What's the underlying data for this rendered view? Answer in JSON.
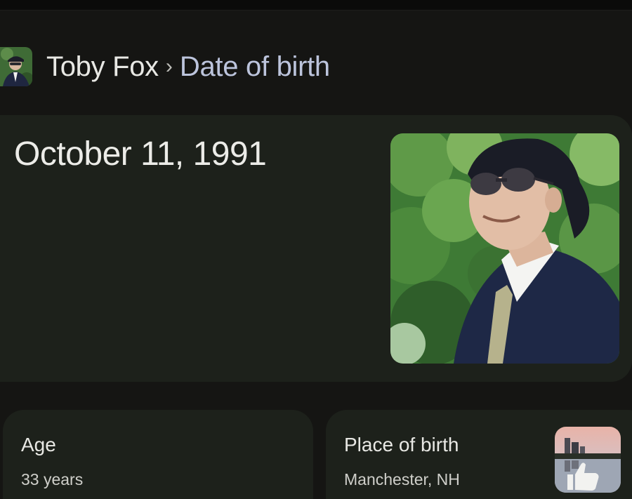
{
  "breadcrumb": {
    "entity": "Toby Fox",
    "separator": "›",
    "attribute": "Date of birth"
  },
  "answer": {
    "value": "October 11, 1991"
  },
  "facts": [
    {
      "title": "Age",
      "value": "33 years"
    },
    {
      "title": "Place of birth",
      "value": "Manchester, NH"
    }
  ],
  "colors": {
    "background": "#151513",
    "card": "#1d211b",
    "attribute_text": "#bcc4dc"
  }
}
